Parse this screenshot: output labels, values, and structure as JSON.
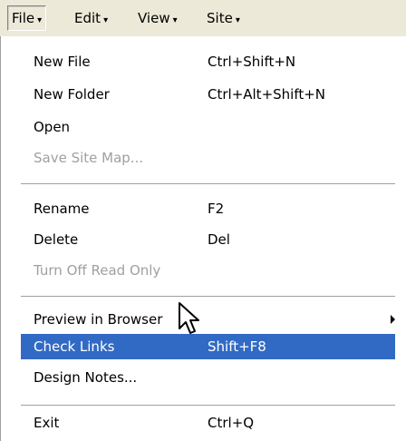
{
  "menubar": {
    "items": [
      {
        "label": "File",
        "caret": "▾"
      },
      {
        "label": "Edit",
        "caret": "▾"
      },
      {
        "label": "View",
        "caret": "▾"
      },
      {
        "label": "Site",
        "caret": "▾"
      }
    ]
  },
  "file_menu": {
    "items": [
      {
        "label": "New File",
        "shortcut": "Ctrl+Shift+N",
        "state": "enabled"
      },
      {
        "label": "New Folder",
        "shortcut": "Ctrl+Alt+Shift+N",
        "state": "enabled"
      },
      {
        "label": "Open",
        "shortcut": "",
        "state": "enabled"
      },
      {
        "label": "Save Site Map...",
        "shortcut": "",
        "state": "disabled"
      },
      {
        "label": "Rename",
        "shortcut": "F2",
        "state": "enabled"
      },
      {
        "label": "Delete",
        "shortcut": "Del",
        "state": "enabled"
      },
      {
        "label": "Turn Off Read Only",
        "shortcut": "",
        "state": "disabled"
      },
      {
        "label": "Preview in Browser",
        "shortcut": "",
        "state": "enabled",
        "submenu": true
      },
      {
        "label": "Check Links",
        "shortcut": "Shift+F8",
        "state": "highlighted"
      },
      {
        "label": "Design Notes...",
        "shortcut": "",
        "state": "enabled"
      },
      {
        "label": "Exit",
        "shortcut": "Ctrl+Q",
        "state": "enabled"
      }
    ]
  },
  "colors": {
    "menubar_bg": "#ece9d8",
    "highlight_bg": "#316ac5",
    "disabled_text": "#a0a0a0"
  },
  "cursor": {
    "icon": "arrow-pointer-icon"
  }
}
